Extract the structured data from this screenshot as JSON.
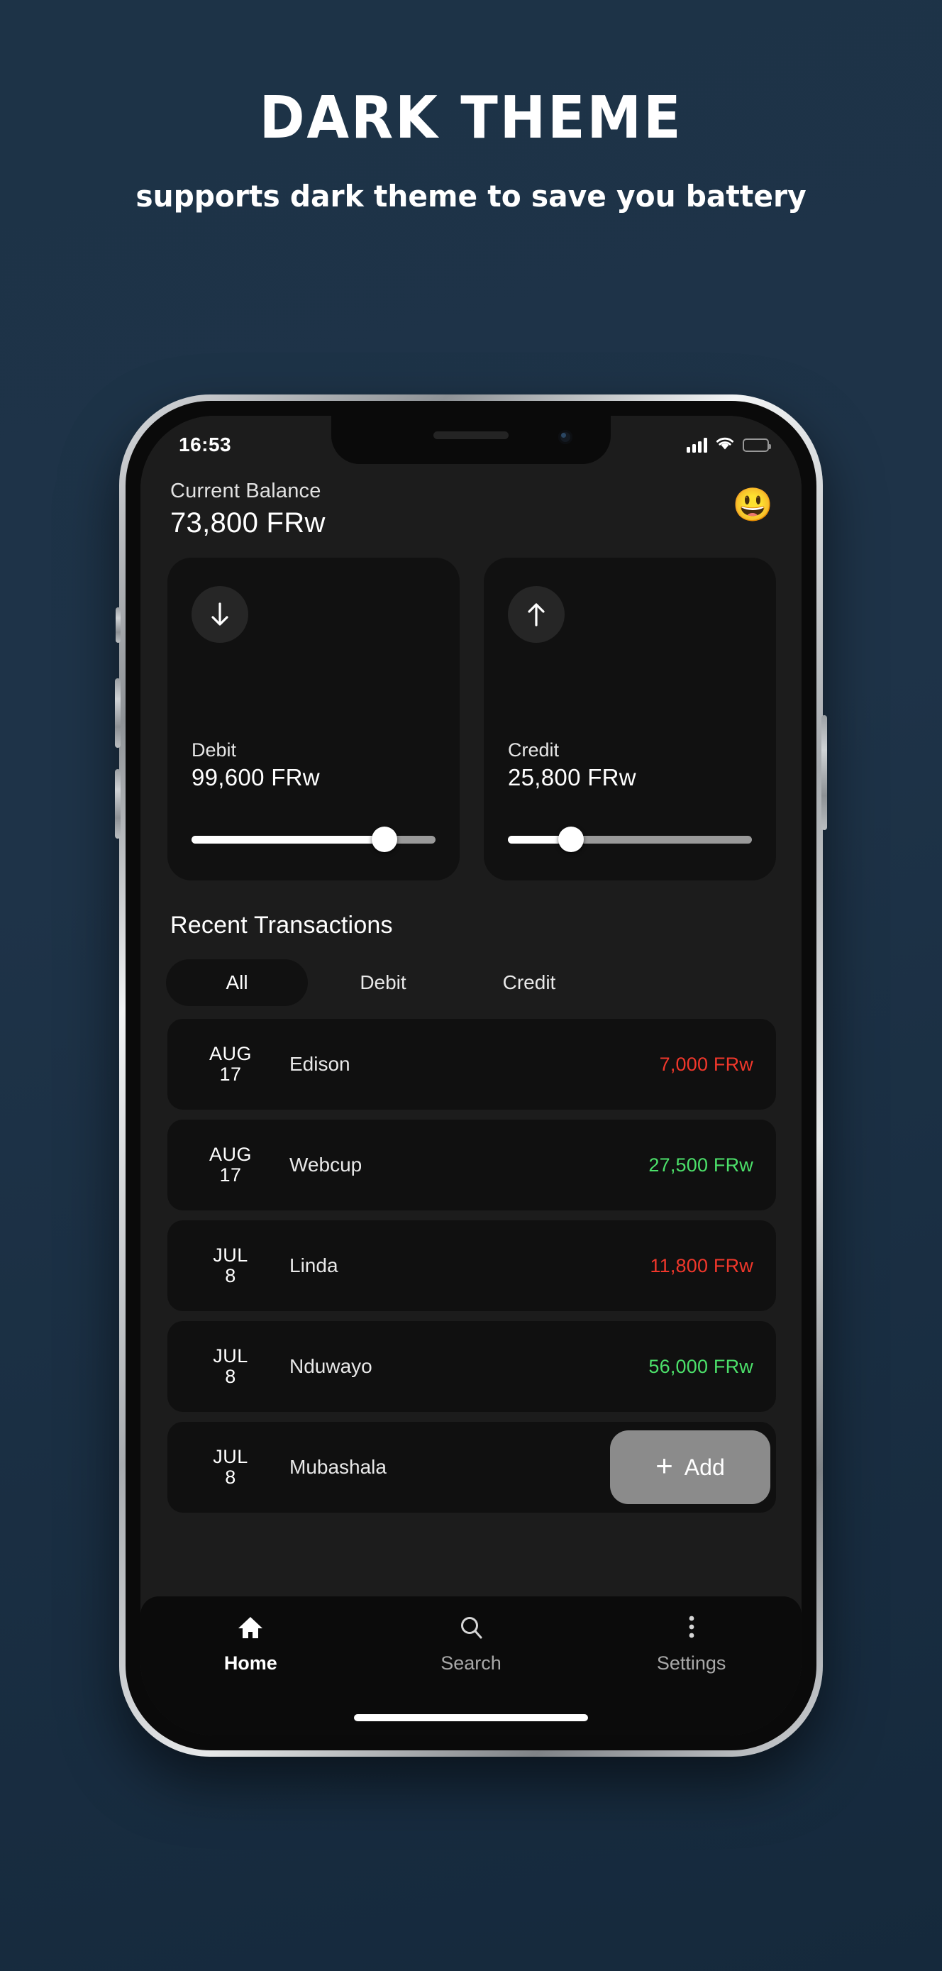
{
  "promo": {
    "title": "DARK THEME",
    "subtitle": "supports dark theme to save you battery"
  },
  "status_bar": {
    "time": "16:53",
    "signal_icon": "cellular-signal-icon",
    "wifi_icon": "wifi-icon",
    "battery_icon": "battery-low-icon",
    "battery_color": "#f5c518"
  },
  "header": {
    "balance_label": "Current Balance",
    "balance_value": "73,800 FRw",
    "emoji": "😃"
  },
  "summary_cards": [
    {
      "icon": "arrow-down-icon",
      "label": "Debit",
      "amount": "99,600 FRw",
      "slider_percent": 79
    },
    {
      "icon": "arrow-up-icon",
      "label": "Credit",
      "amount": "25,800 FRw",
      "slider_percent": 26
    }
  ],
  "transactions_section": {
    "title": "Recent Transactions",
    "tabs": [
      {
        "label": "All",
        "active": true
      },
      {
        "label": "Debit",
        "active": false
      },
      {
        "label": "Credit",
        "active": false
      }
    ],
    "rows": [
      {
        "month": "AUG",
        "day": "17",
        "name": "Edison",
        "amount": "7,000 FRw",
        "type": "debit"
      },
      {
        "month": "AUG",
        "day": "17",
        "name": "Webcup",
        "amount": "27,500 FRw",
        "type": "credit"
      },
      {
        "month": "JUL",
        "day": "8",
        "name": "Linda",
        "amount": "11,800 FRw",
        "type": "debit"
      },
      {
        "month": "JUL",
        "day": "8",
        "name": "Nduwayo",
        "amount": "56,000 FRw",
        "type": "credit"
      },
      {
        "month": "JUL",
        "day": "8",
        "name": "Mubashala",
        "amount": "",
        "type": "debit"
      }
    ],
    "add_button": {
      "label": "Add",
      "icon": "plus-icon"
    }
  },
  "bottom_nav": [
    {
      "label": "Home",
      "icon": "home-icon",
      "active": true
    },
    {
      "label": "Search",
      "icon": "search-icon",
      "active": false
    },
    {
      "label": "Settings",
      "icon": "more-vertical-icon",
      "active": false
    }
  ],
  "colors": {
    "background": "#1d3347",
    "debit": "#f0372b",
    "credit": "#4ce06a",
    "card": "#111111"
  }
}
